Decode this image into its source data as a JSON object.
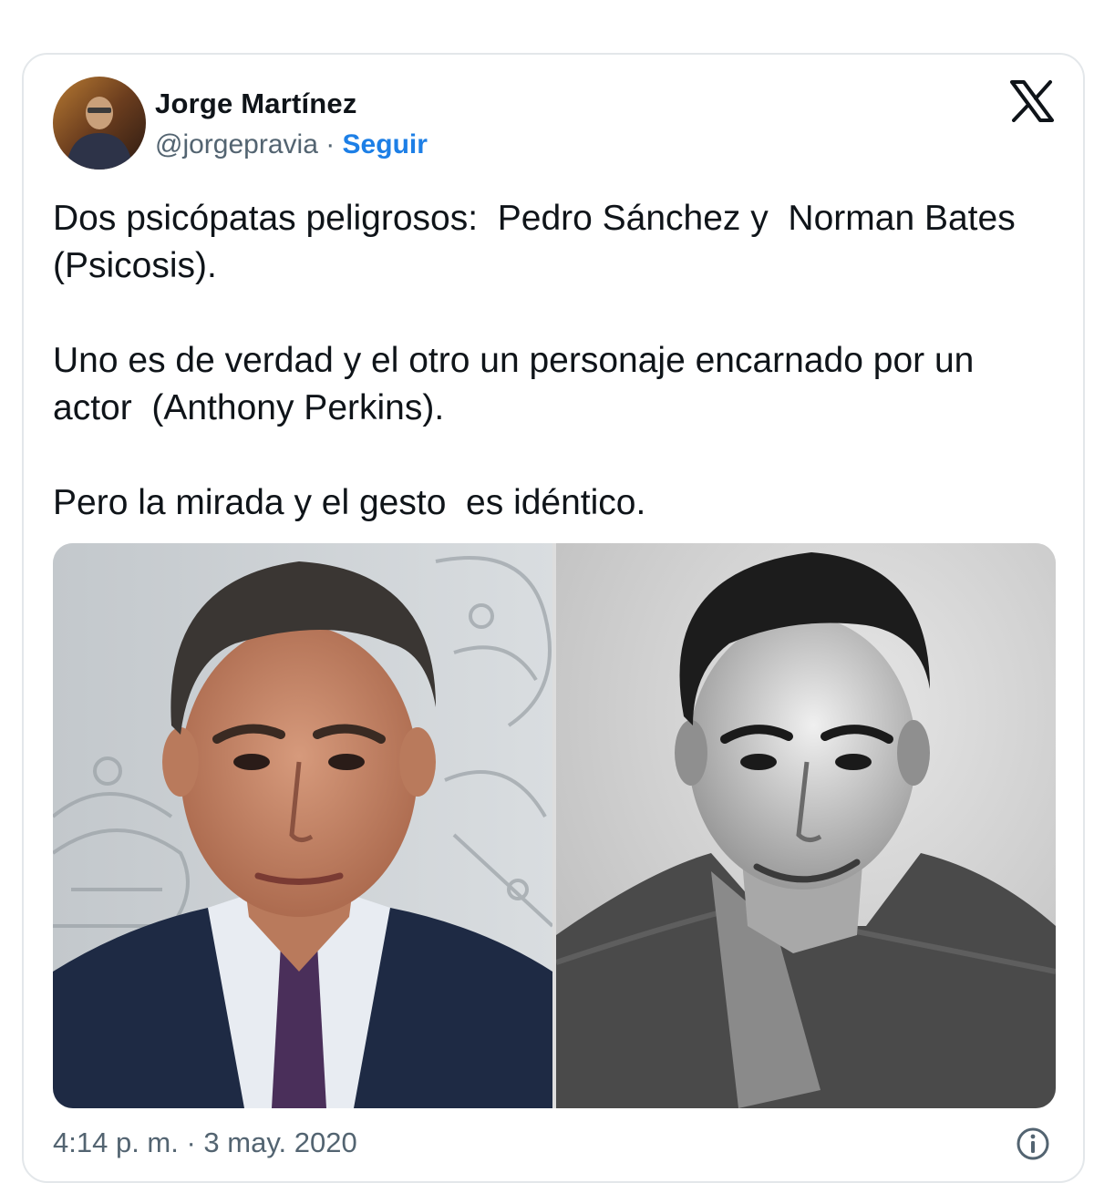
{
  "author": {
    "name": "Jorge Martínez",
    "handle": "@jorgepravia",
    "separator": " · ",
    "follow_label": "Seguir",
    "avatar_icon": "user-avatar-photo"
  },
  "header": {
    "logo_icon": "x-logo-icon"
  },
  "tweet": {
    "paragraphs": [
      "Dos psicópatas peligrosos:  Pedro Sánchez y  Norman Bates  (Psicosis).",
      "Uno es de verdad y el otro un personaje encarnado por un actor  (Anthony Perkins).",
      "Pero la mirada y el gesto  es idéntico."
    ]
  },
  "media": {
    "photos": [
      "man-in-suit-photo",
      "black-and-white-portrait-photo"
    ]
  },
  "footer": {
    "timestamp": "4:14 p. m. · 3 may. 2020",
    "info_icon": "info-icon"
  },
  "colors": {
    "follow": "#1d7fe6",
    "secondary_text": "#536471",
    "border": "#e3e7ea"
  }
}
